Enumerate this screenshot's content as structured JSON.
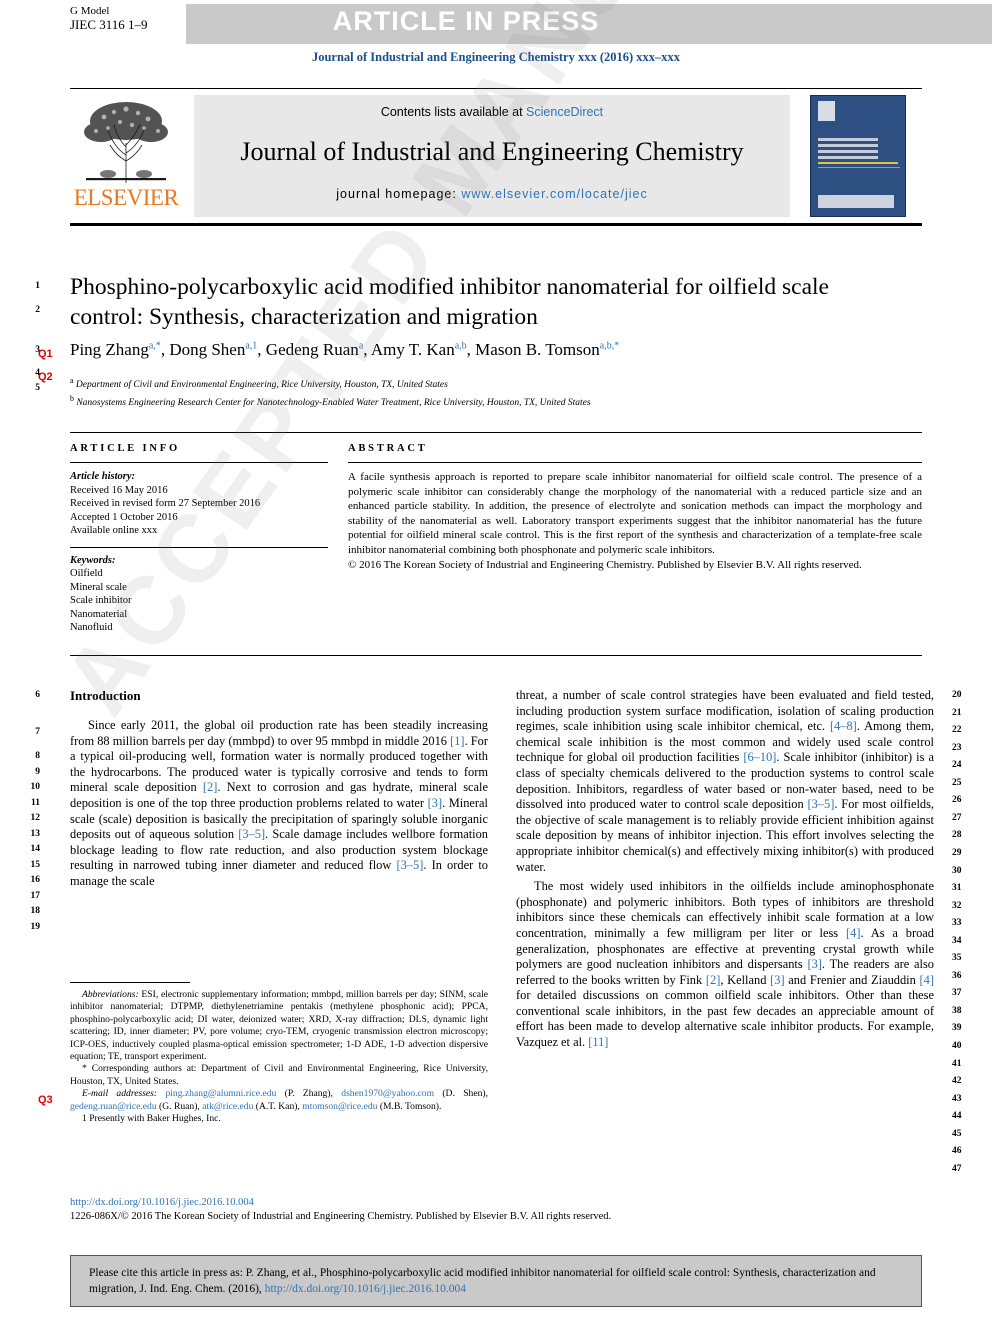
{
  "header": {
    "g_model": "G Model",
    "article_id": "JIEC 3116 1–9",
    "article_in_press": "ARTICLE IN PRESS",
    "journal_ref": "Journal of Industrial and Engineering Chemistry xxx (2016) xxx–xxx"
  },
  "masthead": {
    "contents_prefix": "Contents lists available at ",
    "sciencedirect": "ScienceDirect",
    "journal_title": "Journal of Industrial and Engineering Chemistry",
    "homepage_prefix": "journal homepage: ",
    "homepage_url": "www.elsevier.com/locate/jiec",
    "publisher": "ELSEVIER",
    "cover_title_lines": [
      "JOURNAL OF",
      "INDUSTRIAL AND",
      "ENGINEERING",
      "CHEMISTRY"
    ]
  },
  "article": {
    "title": "Phosphino-polycarboxylic acid modified inhibitor nanomaterial for oilfield scale control: Synthesis, characterization and migration",
    "authors_html": "Ping Zhang<sup>a,*</sup>, Dong Shen<sup>a,1</sup>, Gedeng Ruan<sup>a</sup>, Amy T. Kan<sup>a,b</sup>, Mason B. Tomson<sup>a,b,*</sup>",
    "affiliation_a": "Department of Civil and Environmental Engineering, Rice University, Houston, TX, United States",
    "affiliation_b": "Nanosystems Engineering Research Center for Nanotechnology-Enabled Water Treatment, Rice University, Houston, TX, United States"
  },
  "article_info": {
    "heading": "ARTICLE INFO",
    "history_label": "Article history:",
    "history": [
      "Received 16 May 2016",
      "Received in revised form 27 September 2016",
      "Accepted 1 October 2016",
      "Available online xxx"
    ],
    "keywords_label": "Keywords:",
    "keywords": [
      "Oilfield",
      "Mineral scale",
      "Scale inhibitor",
      "Nanomaterial",
      "Nanofluid"
    ]
  },
  "abstract": {
    "heading": "ABSTRACT",
    "body": "A facile synthesis approach is reported to prepare scale inhibitor nanomaterial for oilfield scale control. The presence of a polymeric scale inhibitor can considerably change the morphology of the nanomaterial with a reduced particle size and an enhanced particle stability. In addition, the presence of electrolyte and sonication methods can impact the morphology and stability of the nanomaterial as well. Laboratory transport experiments suggest that the inhibitor nanomaterial has the future potential for oilfield mineral scale control. This is the first report of the synthesis and characterization of a template-free scale inhibitor nanomaterial combining both phosphonate and polymeric scale inhibitors.",
    "copyright": "© 2016 The Korean Society of Industrial and Engineering Chemistry. Published by Elsevier B.V. All rights reserved."
  },
  "body": {
    "intro_heading": "Introduction",
    "left_paragraph_1_part1": "Since early 2011, the global oil production rate has been steadily increasing from 88 million barrels per day (mmbpd) to over 95 mmbpd in middle 2016 ",
    "left_ref_1": "[1]",
    "left_paragraph_1_part2": ". For a typical oil-producing well, formation water is normally produced together with the hydrocarbons. The produced water is typically corrosive and tends to form mineral scale deposition ",
    "left_ref_2": "[2]",
    "left_paragraph_1_part3": ". Next to corrosion and gas hydrate, mineral scale deposition is one of the top three production problems related to water ",
    "left_ref_3": "[3]",
    "left_paragraph_1_part4": ". Mineral scale (scale) deposition is basically the precipitation of sparingly soluble inorganic deposits out of aqueous solution ",
    "left_ref_4": "[3–5]",
    "left_paragraph_1_part5": ". Scale damage includes wellbore formation blockage leading to flow rate reduction, and also production system blockage resulting in narrowed tubing inner diameter and reduced flow ",
    "left_ref_5": "[3–5]",
    "left_paragraph_1_part6": ". In order to manage the scale",
    "right_paragraph_1_part1": "threat, a number of scale control strategies have been evaluated and field tested, including production system surface modification, isolation of scaling production regimes, scale inhibition using scale inhibitor chemical, etc. ",
    "right_ref_1": "[4–8]",
    "right_paragraph_1_part2": ". Among them, chemical scale inhibition is the most common and widely used scale control technique for global oil production facilities ",
    "right_ref_2": "[6–10]",
    "right_paragraph_1_part3": ". Scale inhibitor (inhibitor) is a class of specialty chemicals delivered to the production systems to control scale deposition. Inhibitors, regardless of water based or non-water based, need to be dissolved into produced water to control scale deposition ",
    "right_ref_3": "[3–5]",
    "right_paragraph_1_part4": ". For most oilfields, the objective of scale management is to reliably provide efficient inhibition against scale deposition by means of inhibitor injection. This effort involves selecting the appropriate inhibitor chemical(s) and effectively mixing inhibitor(s) with produced water.",
    "right_paragraph_2_part1": "The most widely used inhibitors in the oilfields include aminophosphonate (phosphonate) and polymeric inhibitors. Both types of inhibitors are threshold inhibitors since these chemicals can effectively inhibit scale formation at a low concentration, minimally a few milligram per liter or less ",
    "right_ref_4": "[4]",
    "right_paragraph_2_part2": ". As a broad generalization, phosphonates are effective at preventing crystal growth while polymers are good nucleation inhibitors and dispersants ",
    "right_ref_5": "[3]",
    "right_paragraph_2_part3": ". The readers are also referred to the books written by Fink ",
    "right_ref_6": "[2]",
    "right_paragraph_2_part4": ", Kelland ",
    "right_ref_7": "[3]",
    "right_paragraph_2_part5": " and Frenier and Ziauddin ",
    "right_ref_8": "[4]",
    "right_paragraph_2_part6": " for detailed discussions on common oilfield scale inhibitors. Other than these conventional scale inhibitors, in the past few decades an appreciable amount of effort has been made to develop alternative scale inhibitor products. For example, Vazquez et al. ",
    "right_ref_9": "[11]"
  },
  "footnote": {
    "abbrev_label": "Abbreviations:",
    "abbrev_body": " ESI, electronic supplementary information; mmbpd, million barrels per day; SINM, scale inhibitor nanomaterial; DTPMP, diethylenetriamine pentakis (methylene phosphonic acid); PPCA, phosphino-polycarboxylic acid; DI water, deionized water; XRD, X-ray diffraction; DLS, dynamic light scattering; ID, inner diameter; PV, pore volume; cryo-TEM, cryogenic transmission electron microscopy; ICP-OES, inductively coupled plasma-optical emission spectrometer; 1-D ADE, 1-D advection dispersive equation; TE, transport experiment.",
    "corresponding": "* Corresponding authors at: Department of Civil and Environmental Engineering, Rice University, Houston, TX, United States.",
    "email_label": "E-mail addresses:",
    "emails": [
      {
        "addr": "ping.zhang@alumni.rice.edu",
        "who": " (P. Zhang),"
      },
      {
        "addr": "dshen1970@yahoo.com",
        "who": " (D. Shen),"
      },
      {
        "addr": "gedeng.ruan@rice.edu",
        "who": " (G. Ruan),"
      },
      {
        "addr": "atk@rice.edu",
        "who": " (A.T. Kan),"
      },
      {
        "addr": "mtomson@rice.edu",
        "who": " (M.B. Tomson)."
      }
    ],
    "present_address": "1 Presently with Baker Hughes, Inc."
  },
  "bottom": {
    "doi": "http://dx.doi.org/10.1016/j.jiec.2016.10.004",
    "issn_line": "1226-086X/© 2016 The Korean Society of Industrial and Engineering Chemistry. Published by Elsevier B.V. All rights reserved."
  },
  "cite_box": {
    "text_part1": "Please cite this article in press as: P. Zhang, et al., Phosphino-polycarboxylic acid modified inhibitor nanomaterial for oilfield scale control: Synthesis, characterization and migration, J. Ind. Eng. Chem. (2016), ",
    "doi": "http://dx.doi.org/10.1016/j.jiec.2016.10.004"
  },
  "line_numbers": {
    "left": [
      "1",
      "2",
      "3",
      "4",
      "5",
      "6",
      "7",
      "8",
      "9",
      "10",
      "11",
      "12",
      "13",
      "14",
      "15",
      "16",
      "17",
      "18",
      "19"
    ],
    "right": [
      "20",
      "21",
      "22",
      "23",
      "24",
      "25",
      "26",
      "27",
      "28",
      "29",
      "30",
      "31",
      "32",
      "33",
      "34",
      "35",
      "36",
      "37",
      "38",
      "39",
      "40",
      "41",
      "42",
      "43",
      "44",
      "45",
      "46",
      "47"
    ]
  },
  "query_tags": [
    {
      "label": "Q1"
    },
    {
      "label": "Q2"
    },
    {
      "label": "Q3"
    }
  ],
  "watermark": "ACCEPTED MANUSCRIPT",
  "colors": {
    "link": "#2e74b5",
    "journal_ref": "#1a4f8a",
    "elsevier_orange": "#E87722",
    "query_red": "#e00000",
    "aip_band": "#c9c9c9"
  }
}
